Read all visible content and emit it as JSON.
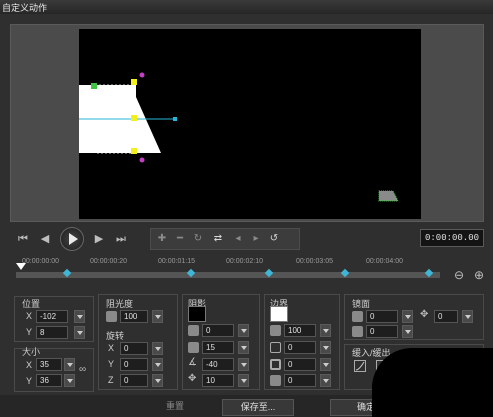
{
  "window": {
    "title": "自定义动作"
  },
  "controls": {
    "timecode": "0:00:00.00"
  },
  "timeline": {
    "labels": [
      "00:00:00:00",
      "00:00:00:20",
      "00:00:01:15",
      "00:00:02:10",
      "00:00:03:05",
      "00:00:04:00"
    ]
  },
  "position": {
    "label": "位置",
    "x_axis": "X",
    "y_axis": "Y",
    "x": "-102",
    "y": "8"
  },
  "size": {
    "label": "大小",
    "x_axis": "X",
    "y_axis": "Y",
    "x": "35",
    "y": "36"
  },
  "opacity": {
    "label": "阻光度",
    "value": "100"
  },
  "rotation": {
    "label": "旋转",
    "x_axis": "X",
    "y_axis": "Y",
    "z_axis": "Z",
    "x": "0",
    "y": "0",
    "z": "0"
  },
  "shadow": {
    "label": "阴影",
    "opacity": "0",
    "blur": "15",
    "angle": "-40",
    "distance": "10"
  },
  "border": {
    "label": "边界",
    "opacity": "100",
    "v1": "0",
    "v2": "0",
    "v3": "0"
  },
  "mirror": {
    "label": "镜面",
    "v1": "0",
    "v2": "0",
    "v3": "0"
  },
  "ease": {
    "label": "缓入/缓出"
  },
  "buttons": {
    "reset": "重置",
    "save": "保存至...",
    "ok": "确定"
  },
  "colors": {
    "timeline_key": "#3fb6d6",
    "handle_yellow": "#f2ef1a",
    "handle_green": "#3ec43e",
    "handle_magenta": "#c23fc2",
    "path_cyan": "#27b6d9"
  }
}
